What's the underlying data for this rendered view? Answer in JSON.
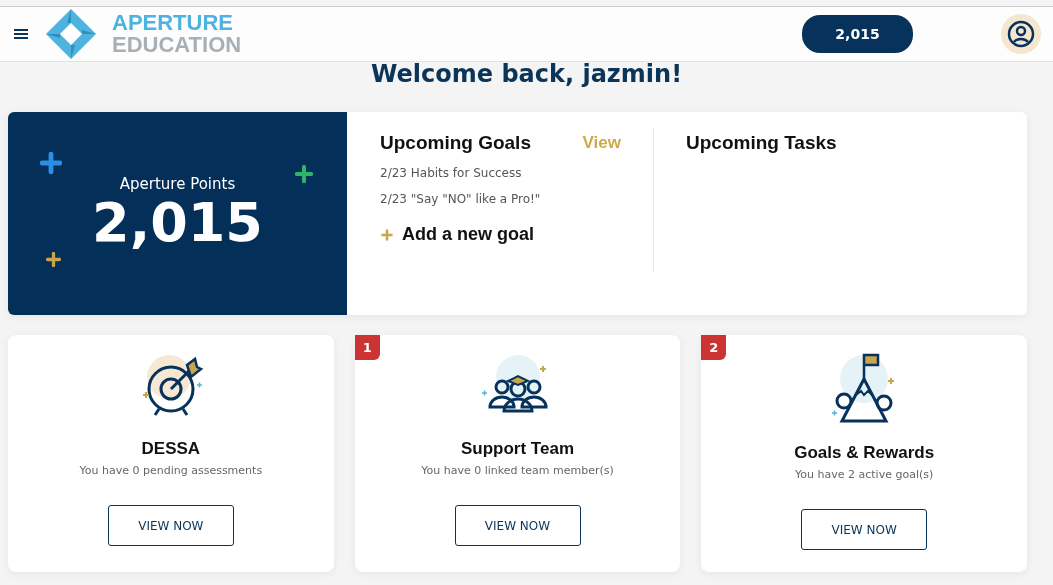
{
  "header": {
    "logo_top": "APERTURE",
    "logo_bottom": "EDUCATION",
    "points_pill": "2,015"
  },
  "welcome": "Welcome back, jazmin!",
  "points_card": {
    "label": "Aperture Points",
    "value": "2,015"
  },
  "goals": {
    "title": "Upcoming Goals",
    "link": "View",
    "items": [
      "2/23 Habits for Success",
      "2/23 \"Say \"NO\" like a Pro!\""
    ],
    "add": "Add a new goal"
  },
  "tasks": {
    "title": "Upcoming Tasks"
  },
  "cards": [
    {
      "kind": "target",
      "title": "DESSA",
      "subtitle": "You have 0 pending assessments",
      "button": "VIEW NOW"
    },
    {
      "kind": "team",
      "badge": "1",
      "title": "Support Team",
      "subtitle": "You have 0 linked team member(s)",
      "button": "VIEW NOW"
    },
    {
      "kind": "mountain",
      "badge": "2",
      "title": "Goals & Rewards",
      "subtitle": "You have 2 active goal(s)",
      "button": "VIEW NOW"
    }
  ]
}
